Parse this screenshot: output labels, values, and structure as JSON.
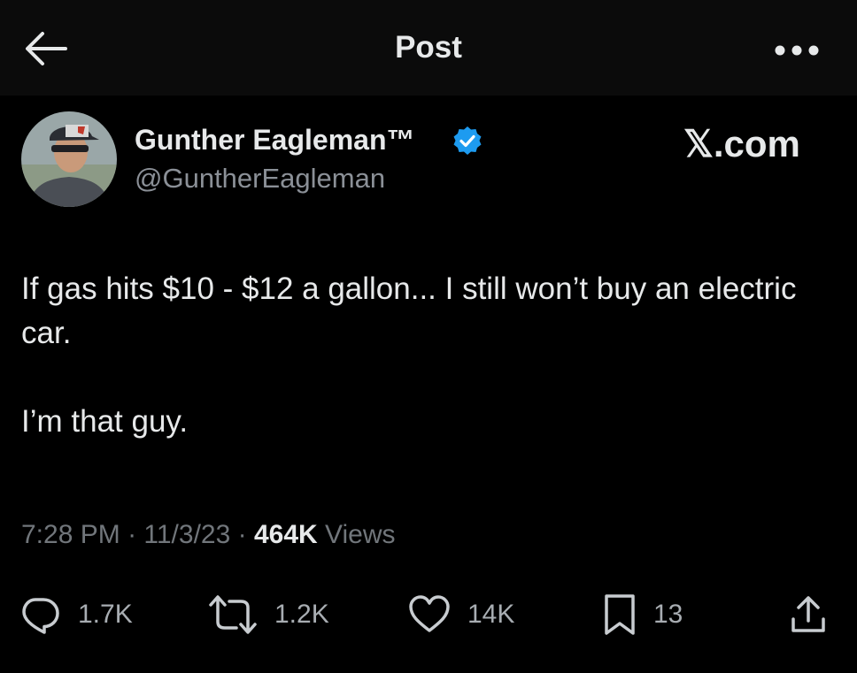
{
  "header": {
    "back_icon": "arrow-left-icon",
    "title": "Post",
    "more_icon": "more-horizontal-icon"
  },
  "author": {
    "display_name": "Gunther Eagleman™",
    "handle": "@GuntherEagleman",
    "verified_color": "#1d9bf0"
  },
  "brand": "𝕏.com",
  "post": {
    "paragraph_1": "If gas hits $10 - $12 a gallon... I still won’t buy an electric car.",
    "paragraph_2": "I’m that guy."
  },
  "meta": {
    "time": "7:28 PM",
    "separator": " · ",
    "date": "11/3/23",
    "views_count": "464K",
    "views_label": " Views"
  },
  "actions": {
    "replies": "1.7K",
    "reposts": "1.2K",
    "likes": "14K",
    "bookmarks": "13",
    "share_icon": "share-icon"
  },
  "colors": {
    "background": "#000000",
    "header_background": "#0b0b0b",
    "text": "#e7e9ea",
    "secondary_text": "#71767b"
  }
}
